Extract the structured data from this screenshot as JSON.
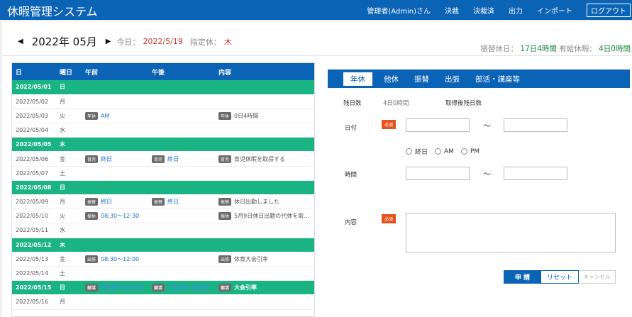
{
  "app": {
    "title": "休暇管理システム"
  },
  "nav": {
    "user": "管理者(Admin)さん",
    "items": [
      "決裁",
      "決裁済",
      "出力",
      "インポート"
    ],
    "logout": "ログアウト"
  },
  "month": {
    "prev": "◀",
    "label": "2022年 05月",
    "next": "▶",
    "today_label": "今日：",
    "today_value": "2022/5/19",
    "spec_label": "指定休：",
    "spec_value": "木"
  },
  "balance": {
    "transfer_label": "振替休日：",
    "transfer_value": "17日4時間",
    "paid_label": "有給休暇：",
    "paid_value": "4日0時間"
  },
  "table": {
    "headers": [
      "日",
      "曜日",
      "午前",
      "午後",
      "内容"
    ],
    "rows": [
      {
        "date": "2022/05/01",
        "dow": "日",
        "holiday": true,
        "am_badge": "",
        "am": "",
        "pm_badge": "",
        "pm": "",
        "c_badge": "",
        "content": ""
      },
      {
        "date": "2022/05/02",
        "dow": "月",
        "holiday": false,
        "am_badge": "",
        "am": "",
        "pm_badge": "",
        "pm": "",
        "c_badge": "",
        "content": ""
      },
      {
        "date": "2022/05/03",
        "dow": "火",
        "holiday": false,
        "am_badge": "年休",
        "am": "AM",
        "pm_badge": "",
        "pm": "",
        "c_badge": "年休",
        "content": "0日4時間"
      },
      {
        "date": "2022/05/04",
        "dow": "水",
        "holiday": false,
        "am_badge": "",
        "am": "",
        "pm_badge": "",
        "pm": "",
        "c_badge": "",
        "content": ""
      },
      {
        "date": "2022/05/05",
        "dow": "木",
        "holiday": true,
        "am_badge": "",
        "am": "",
        "pm_badge": "",
        "pm": "",
        "c_badge": "",
        "content": ""
      },
      {
        "date": "2022/05/06",
        "dow": "金",
        "holiday": false,
        "am_badge": "育児",
        "am": "終日",
        "pm_badge": "育児",
        "pm": "終日",
        "c_badge": "育児",
        "content": "育児休暇を取得する"
      },
      {
        "date": "2022/05/07",
        "dow": "土",
        "holiday": false,
        "am_badge": "",
        "am": "",
        "pm_badge": "",
        "pm": "",
        "c_badge": "",
        "content": ""
      },
      {
        "date": "2022/05/08",
        "dow": "日",
        "holiday": true,
        "am_badge": "",
        "am": "",
        "pm_badge": "",
        "pm": "",
        "c_badge": "",
        "content": ""
      },
      {
        "date": "2022/05/09",
        "dow": "月",
        "holiday": false,
        "am_badge": "振替",
        "am": "終日",
        "pm_badge": "振替",
        "pm": "終日",
        "c_badge": "振替",
        "content": "休日出勤しました"
      },
      {
        "date": "2022/05/10",
        "dow": "火",
        "holiday": false,
        "am_badge": "振休",
        "am": "08:30～12:30",
        "pm_badge": "",
        "pm": "",
        "c_badge": "振休",
        "content": "5月9日休日出勤の代休を取得…"
      },
      {
        "date": "2022/05/11",
        "dow": "水",
        "holiday": false,
        "am_badge": "",
        "am": "",
        "pm_badge": "",
        "pm": "",
        "c_badge": "",
        "content": ""
      },
      {
        "date": "2022/05/12",
        "dow": "木",
        "holiday": true,
        "am_badge": "",
        "am": "",
        "pm_badge": "",
        "pm": "",
        "c_badge": "",
        "content": ""
      },
      {
        "date": "2022/05/13",
        "dow": "金",
        "holiday": false,
        "am_badge": "出張",
        "am": "08:30～12:00",
        "pm_badge": "",
        "pm": "",
        "c_badge": "出張",
        "content": "体育大会引率"
      },
      {
        "date": "2022/05/14",
        "dow": "土",
        "holiday": false,
        "am_badge": "",
        "am": "",
        "pm_badge": "",
        "pm": "",
        "c_badge": "",
        "content": ""
      },
      {
        "date": "2022/05/15",
        "dow": "日",
        "holiday": true,
        "am_badge": "部活",
        "am": "09:00～12:00",
        "pm_badge": "部活",
        "pm": "13:00～15:00",
        "c_badge": "部活",
        "content": "大会引率"
      },
      {
        "date": "2022/05/16",
        "dow": "月",
        "holiday": false,
        "am_badge": "",
        "am": "",
        "pm_badge": "",
        "pm": "",
        "c_badge": "",
        "content": ""
      }
    ]
  },
  "tabs": [
    "年休",
    "他休",
    "振替",
    "出張",
    "部活・講座等"
  ],
  "form": {
    "remaining_label": "残日数",
    "remaining_value": "4日0時間",
    "after_label": "取得後残日数",
    "date_label": "日付",
    "required": "必須",
    "tilde": "〜",
    "radio_all": "終日",
    "radio_am": "AM",
    "radio_pm": "PM",
    "time_label": "時間",
    "content_label": "内容"
  },
  "buttons": {
    "submit": "申 請",
    "reset": "リセット",
    "cancel": "キャンセル"
  }
}
